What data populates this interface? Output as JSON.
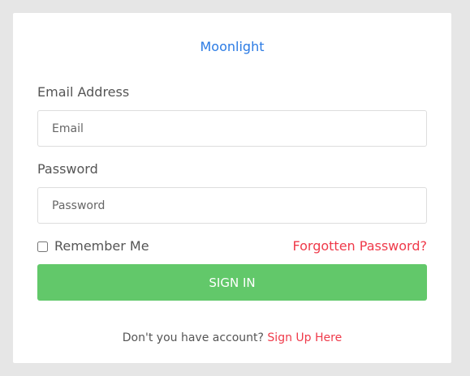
{
  "brand": {
    "name": "Moonlight"
  },
  "form": {
    "email_label": "Email Address",
    "email_placeholder": "Email",
    "email_value": "",
    "password_label": "Password",
    "password_placeholder": "Password",
    "password_value": "",
    "remember_label": "Remember Me",
    "remember_checked": false,
    "forgot_label": "Forgotten Password?",
    "submit_label": "SIGN IN"
  },
  "footer": {
    "prompt": "Don't you have account?",
    "signup_label": "Sign Up Here"
  },
  "colors": {
    "page_background": "#e6e6e6",
    "card_background": "#ffffff",
    "brand_link": "#2b7be4",
    "accent_link": "#ef3a4a",
    "button_background": "#62c86a"
  }
}
